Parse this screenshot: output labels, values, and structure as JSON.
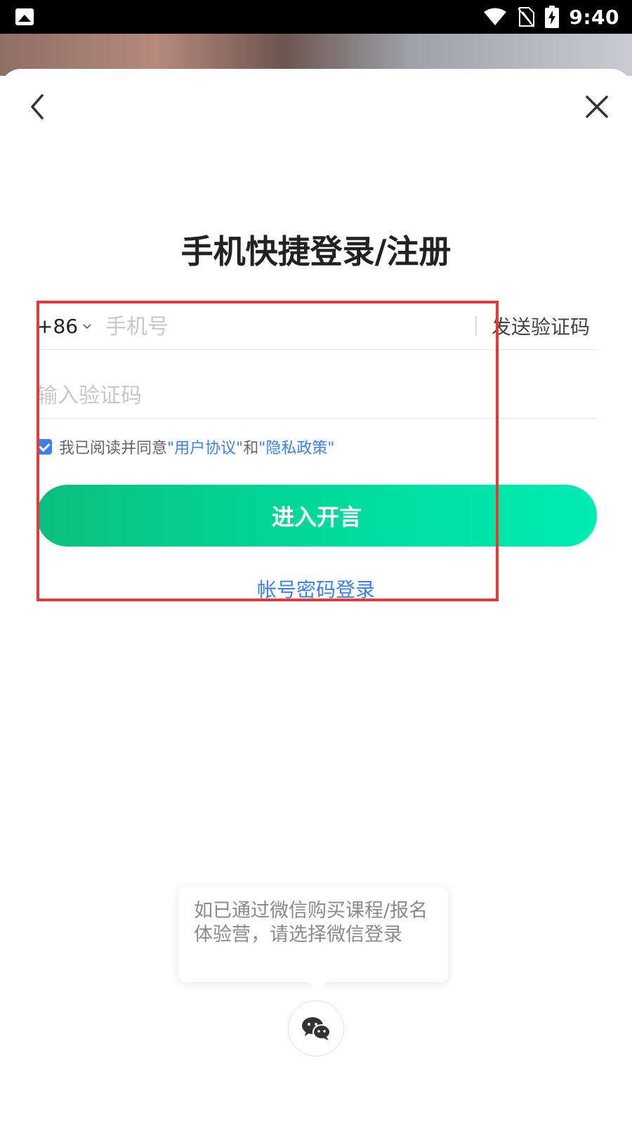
{
  "status_bar": {
    "time": "9:40",
    "icons": [
      "gallery-icon",
      "wifi-icon",
      "no-sim-icon",
      "battery-charging-icon"
    ]
  },
  "nav": {
    "back_icon": "chevron-left-icon",
    "close_icon": "close-icon"
  },
  "title": "手机快捷登录/注册",
  "phone": {
    "country_code": "+86",
    "placeholder": "手机号",
    "value": "",
    "send_code_label": "发送验证码"
  },
  "code": {
    "placeholder": "输入验证码",
    "value": ""
  },
  "agreement": {
    "checked": true,
    "prefix": "我已阅读并同意",
    "user_agreement": "\"用户协议\"",
    "and": "和",
    "privacy_policy": "\"隐私政策\""
  },
  "enter_button": "进入开言",
  "password_login": "帐号密码登录",
  "wechat": {
    "tooltip": "如已通过微信购买课程/报名体验营，请选择微信登录",
    "icon": "wechat-icon"
  },
  "colors": {
    "accent_blue": "#3b7ff0",
    "button_gradient_start": "#0bbf7d",
    "button_gradient_end": "#00ecb2",
    "highlight_red": "#e53935"
  }
}
